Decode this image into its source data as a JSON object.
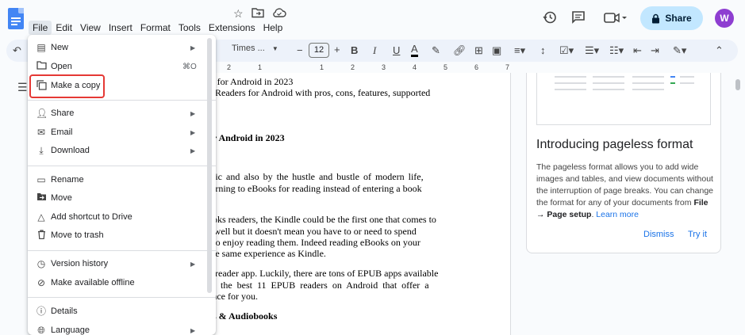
{
  "app": {
    "accent": "#1a73e8",
    "share_color": "#c2e7ff",
    "avatar_color": "#8e3ed1"
  },
  "menubar": [
    "File",
    "Edit",
    "View",
    "Insert",
    "Format",
    "Tools",
    "Extensions",
    "Help"
  ],
  "header": {
    "share_label": "Share",
    "avatar_initial": "W"
  },
  "toolbar": {
    "font": "Times ...",
    "font_size": "12"
  },
  "ruler": {
    "ticks": [
      "2",
      "1",
      "1",
      "2",
      "3",
      "4",
      "5",
      "6",
      "7"
    ]
  },
  "file_menu": {
    "new": "New",
    "open": "Open",
    "open_shortcut": "⌘O",
    "make_copy": "Make a copy",
    "share": "Share",
    "email": "Email",
    "download": "Download",
    "rename": "Rename",
    "move": "Move",
    "add_shortcut": "Add shortcut to Drive",
    "move_trash": "Move to trash",
    "version_history": "Version history",
    "offline": "Make available offline",
    "details": "Details",
    "language": "Language"
  },
  "document": {
    "lines": [
      "rs for Android in 2023",
      "3 Readers for Android with pros, cons, features, supported",
      "r Android in 2023",
      "mic and also by the hustle and bustle of modern life,",
      "turning to eBooks for reading instead of entering a book",
      "ooks readers, the Kindle could be the first one that comes to",
      "s well but it doesn't mean you have to or need to spend",
      "t to enjoy reading them. Indeed reading eBooks on your",
      "the same experience as Kindle.",
      "3 reader app. Luckily, there are tons of EPUB apps available",
      "of the best 11 EPUB readers on Android that offer a",
      "ence for you.",
      "s & Audiobooks"
    ]
  },
  "side_panel": {
    "title": "Introducing pageless format",
    "body_1": "The pageless format allows you to add wide images and tables, and view documents without the interruption of page breaks. You can change the format for any of your documents from",
    "body_bold": "File → Page setup",
    "body_end": ".",
    "learn_more": "Learn more",
    "dismiss": "Dismiss",
    "try_it": "Try it"
  }
}
